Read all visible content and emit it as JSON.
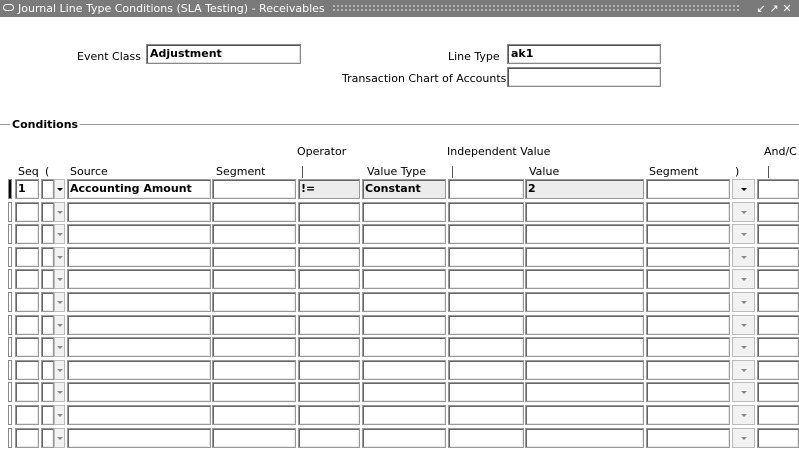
{
  "window": {
    "title": "Journal Line Type Conditions (SLA Testing) - Receivables"
  },
  "header": {
    "event_class_label": "Event Class",
    "event_class_value": "Adjustment",
    "line_type_label": "Line Type",
    "line_type_value": "ak1",
    "tca_label": "Transaction Chart of Accounts",
    "tca_value": ""
  },
  "conditions": {
    "section_title": "Conditions",
    "group_headers": {
      "operator": "Operator",
      "independent_value": "Independent Value",
      "and_or": "And/C"
    },
    "columns": {
      "seq": "Seq",
      "open_paren": "(",
      "source": "Source",
      "segment": "Segment",
      "value_type": "Value Type",
      "value": "Value",
      "segment2": "Segment",
      "close_paren": ")"
    },
    "rows": [
      {
        "seq": "1",
        "open_paren": "",
        "source": "Accounting Amount",
        "segment": "",
        "operator": "!=",
        "value_type": "Constant",
        "ind_value": "",
        "value": "2",
        "segment2": "",
        "close_paren": "",
        "and_or": ""
      },
      {
        "seq": "",
        "open_paren": "",
        "source": "",
        "segment": "",
        "operator": "",
        "value_type": "",
        "ind_value": "",
        "value": "",
        "segment2": "",
        "close_paren": "",
        "and_or": ""
      },
      {
        "seq": "",
        "open_paren": "",
        "source": "",
        "segment": "",
        "operator": "",
        "value_type": "",
        "ind_value": "",
        "value": "",
        "segment2": "",
        "close_paren": "",
        "and_or": ""
      },
      {
        "seq": "",
        "open_paren": "",
        "source": "",
        "segment": "",
        "operator": "",
        "value_type": "",
        "ind_value": "",
        "value": "",
        "segment2": "",
        "close_paren": "",
        "and_or": ""
      },
      {
        "seq": "",
        "open_paren": "",
        "source": "",
        "segment": "",
        "operator": "",
        "value_type": "",
        "ind_value": "",
        "value": "",
        "segment2": "",
        "close_paren": "",
        "and_or": ""
      },
      {
        "seq": "",
        "open_paren": "",
        "source": "",
        "segment": "",
        "operator": "",
        "value_type": "",
        "ind_value": "",
        "value": "",
        "segment2": "",
        "close_paren": "",
        "and_or": ""
      },
      {
        "seq": "",
        "open_paren": "",
        "source": "",
        "segment": "",
        "operator": "",
        "value_type": "",
        "ind_value": "",
        "value": "",
        "segment2": "",
        "close_paren": "",
        "and_or": ""
      },
      {
        "seq": "",
        "open_paren": "",
        "source": "",
        "segment": "",
        "operator": "",
        "value_type": "",
        "ind_value": "",
        "value": "",
        "segment2": "",
        "close_paren": "",
        "and_or": ""
      },
      {
        "seq": "",
        "open_paren": "",
        "source": "",
        "segment": "",
        "operator": "",
        "value_type": "",
        "ind_value": "",
        "value": "",
        "segment2": "",
        "close_paren": "",
        "and_or": ""
      },
      {
        "seq": "",
        "open_paren": "",
        "source": "",
        "segment": "",
        "operator": "",
        "value_type": "",
        "ind_value": "",
        "value": "",
        "segment2": "",
        "close_paren": "",
        "and_or": ""
      },
      {
        "seq": "",
        "open_paren": "",
        "source": "",
        "segment": "",
        "operator": "",
        "value_type": "",
        "ind_value": "",
        "value": "",
        "segment2": "",
        "close_paren": "",
        "and_or": ""
      },
      {
        "seq": "",
        "open_paren": "",
        "source": "",
        "segment": "",
        "operator": "",
        "value_type": "",
        "ind_value": "",
        "value": "",
        "segment2": "",
        "close_paren": "",
        "and_or": ""
      }
    ]
  }
}
